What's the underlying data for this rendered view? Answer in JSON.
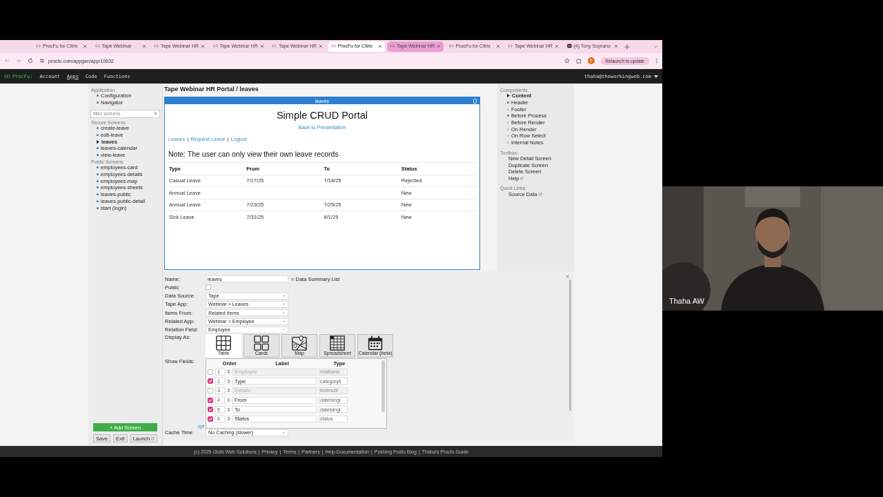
{
  "browser": {
    "tabs": [
      {
        "title": "ProcFu for Citrix",
        "kind": "procfu",
        "selected": false,
        "highlighted": false
      },
      {
        "title": "Tape Webinar",
        "kind": "procfu",
        "selected": false,
        "highlighted": false
      },
      {
        "title": "Tape Webinar HR",
        "kind": "procfu",
        "selected": false,
        "highlighted": false
      },
      {
        "title": "Tape Webinar HR",
        "kind": "procfu",
        "selected": false,
        "highlighted": false
      },
      {
        "title": "Tape Webinar HR",
        "kind": "procfu",
        "selected": false,
        "highlighted": false
      },
      {
        "title": "ProcFu for Citrix",
        "kind": "procfu",
        "selected": true,
        "highlighted": false
      },
      {
        "title": "Tape Webinar HR",
        "kind": "procfu",
        "selected": false,
        "highlighted": true
      },
      {
        "title": "ProcFu for Citrix",
        "kind": "procfu",
        "selected": false,
        "highlighted": false
      },
      {
        "title": "Tape Webinar HR",
        "kind": "procfu",
        "selected": false,
        "highlighted": false
      },
      {
        "title": "(4) Tony Soprano",
        "kind": "media",
        "selected": false,
        "highlighted": false
      }
    ],
    "url": "procfu.com/appgen/app/10632",
    "profile_initial": "T",
    "relaunch_button": "Relaunch to update"
  },
  "app_nav": {
    "brand": "ProcFu:",
    "menu": [
      {
        "label": "Account",
        "selected": false
      },
      {
        "label": "Apps",
        "selected": true
      },
      {
        "label": "Code",
        "selected": false
      },
      {
        "label": "Functions",
        "selected": false
      }
    ],
    "user": "thaha@theworkingweb.com"
  },
  "sidebar": {
    "application": {
      "title": "Application",
      "items": [
        {
          "label": "Configuration",
          "selected": false
        },
        {
          "label": "Navigator",
          "selected": false
        }
      ]
    },
    "filter": {
      "placeholder": "filter screens",
      "clear": "X"
    },
    "secure_screens": {
      "title": "Secure Screens",
      "items": [
        {
          "label": "create-leave",
          "selected": false
        },
        {
          "label": "edit-leave",
          "selected": false
        },
        {
          "label": "leaves",
          "selected": true
        },
        {
          "label": "leaves-calendar",
          "selected": false
        },
        {
          "label": "view-leave",
          "selected": false
        }
      ]
    },
    "public_screens": {
      "title": "Public Screens",
      "items": [
        {
          "label": "employees-card",
          "selected": false
        },
        {
          "label": "employees-details",
          "selected": false
        },
        {
          "label": "employees-map",
          "selected": false
        },
        {
          "label": "employees-sheets",
          "selected": false
        },
        {
          "label": "leaves-public",
          "selected": false
        },
        {
          "label": "leaves-public-detail",
          "selected": false
        },
        {
          "label": "start (login)",
          "selected": false
        }
      ]
    },
    "add_button": "+ Add Screen",
    "buttons": [
      {
        "label": "Save",
        "external": false
      },
      {
        "label": "Exit",
        "external": false
      },
      {
        "label": "Launch",
        "external": true
      }
    ]
  },
  "breadcrumb": "Tape Webinar HR Portal / leaves",
  "preview": {
    "title": "leaves",
    "heading": "Simple CRUD Portal",
    "back_link": "Back to Presentation",
    "nav_links": [
      "Leaves",
      "Request Leave",
      "Logout"
    ],
    "nav_separator": "|",
    "note": "Note: The user can only view their own leave records",
    "table": {
      "columns": [
        "Type",
        "From",
        "To",
        "Status"
      ],
      "rows": [
        [
          "Casual Leave",
          "7/17/25",
          "7/18/25",
          "Rejected"
        ],
        [
          "Annual Leave",
          "",
          "",
          "New"
        ],
        [
          "Annual Leave",
          "7/23/25",
          "7/25/25",
          "New"
        ],
        [
          "Sick Leave",
          "7/31/25",
          "8/1/25",
          "New"
        ]
      ]
    }
  },
  "components": {
    "title": "Components:",
    "items": [
      {
        "label": "Content",
        "selected": true,
        "filled": false
      },
      {
        "label": "Header",
        "selected": false,
        "filled": true
      },
      {
        "label": "Footer",
        "selected": false,
        "filled": false
      },
      {
        "label": "Before Process",
        "selected": false,
        "filled": true
      },
      {
        "label": "Before Render",
        "selected": false,
        "filled": false
      },
      {
        "label": "On Render",
        "selected": false,
        "filled": false
      },
      {
        "label": "On Row Select",
        "selected": false,
        "filled": false
      },
      {
        "label": "Internal Notes",
        "selected": false,
        "filled": false
      }
    ]
  },
  "toolbox": {
    "title": "Toolbox:",
    "items": [
      {
        "label": "New Detail Screen",
        "external": false
      },
      {
        "label": "Duplicate Screen",
        "external": false
      },
      {
        "label": "Delete Screen",
        "external": false
      },
      {
        "label": "Help",
        "external": true
      }
    ]
  },
  "quick_links": {
    "title": "Quick Links:",
    "items": [
      {
        "label": "Source Data",
        "external": true
      }
    ]
  },
  "form": {
    "name": {
      "label": "Name:",
      "value": "leaves",
      "suffix": "= Data Summary List"
    },
    "public": {
      "label": "Public",
      "checked": false
    },
    "selects": [
      {
        "label": "Data Source:",
        "value": "Tape"
      },
      {
        "label": "Tape App:",
        "value": "Webinar > Leaves"
      },
      {
        "label": "Items From:",
        "value": "Related Items"
      },
      {
        "label": "Related App:",
        "value": "Webinar > Employee"
      },
      {
        "label": "Relation Field:",
        "value": "Employee"
      }
    ],
    "display_as": {
      "label": "Display As:",
      "options": [
        {
          "label": "Table",
          "kind": "table",
          "selected": true
        },
        {
          "label": "Cards",
          "kind": "cards",
          "selected": false
        },
        {
          "label": "Map",
          "kind": "map",
          "selected": false
        },
        {
          "label": "Spreadsheet",
          "kind": "spreadsheet",
          "selected": false
        },
        {
          "label": "Calendar (beta)",
          "kind": "calendar",
          "selected": false
        }
      ]
    },
    "show_fields": {
      "label": "Show Fields:",
      "opt_link": "opt",
      "columns": [
        "Order",
        "Label",
        "Type"
      ],
      "rows": [
        {
          "checked": false,
          "order": "1",
          "label": "Employee",
          "type": "relationsi"
        },
        {
          "checked": true,
          "order": "2",
          "label": "Type",
          "type": "categoryfi"
        },
        {
          "checked": false,
          "order": "3",
          "label": "Details",
          "type": "textmulti"
        },
        {
          "checked": true,
          "order": "4",
          "label": "From",
          "type": "datelsingl"
        },
        {
          "checked": true,
          "order": "5",
          "label": "To",
          "type": "datelsingl"
        },
        {
          "checked": true,
          "order": "6",
          "label": "Status",
          "type": "status"
        }
      ]
    },
    "cache_time": {
      "label": "Cache Time:",
      "value": "No Caching (slower)"
    }
  },
  "footer": {
    "copyright": "(c) 2025 Globi Web Solutions",
    "links": [
      "Privacy",
      "Terms",
      "Partners",
      "Help Documentation",
      "Pushing Podio Blog",
      "Thaha's Procfu Guide"
    ],
    "separator": "|"
  },
  "video": {
    "name": "Thaha AW"
  }
}
